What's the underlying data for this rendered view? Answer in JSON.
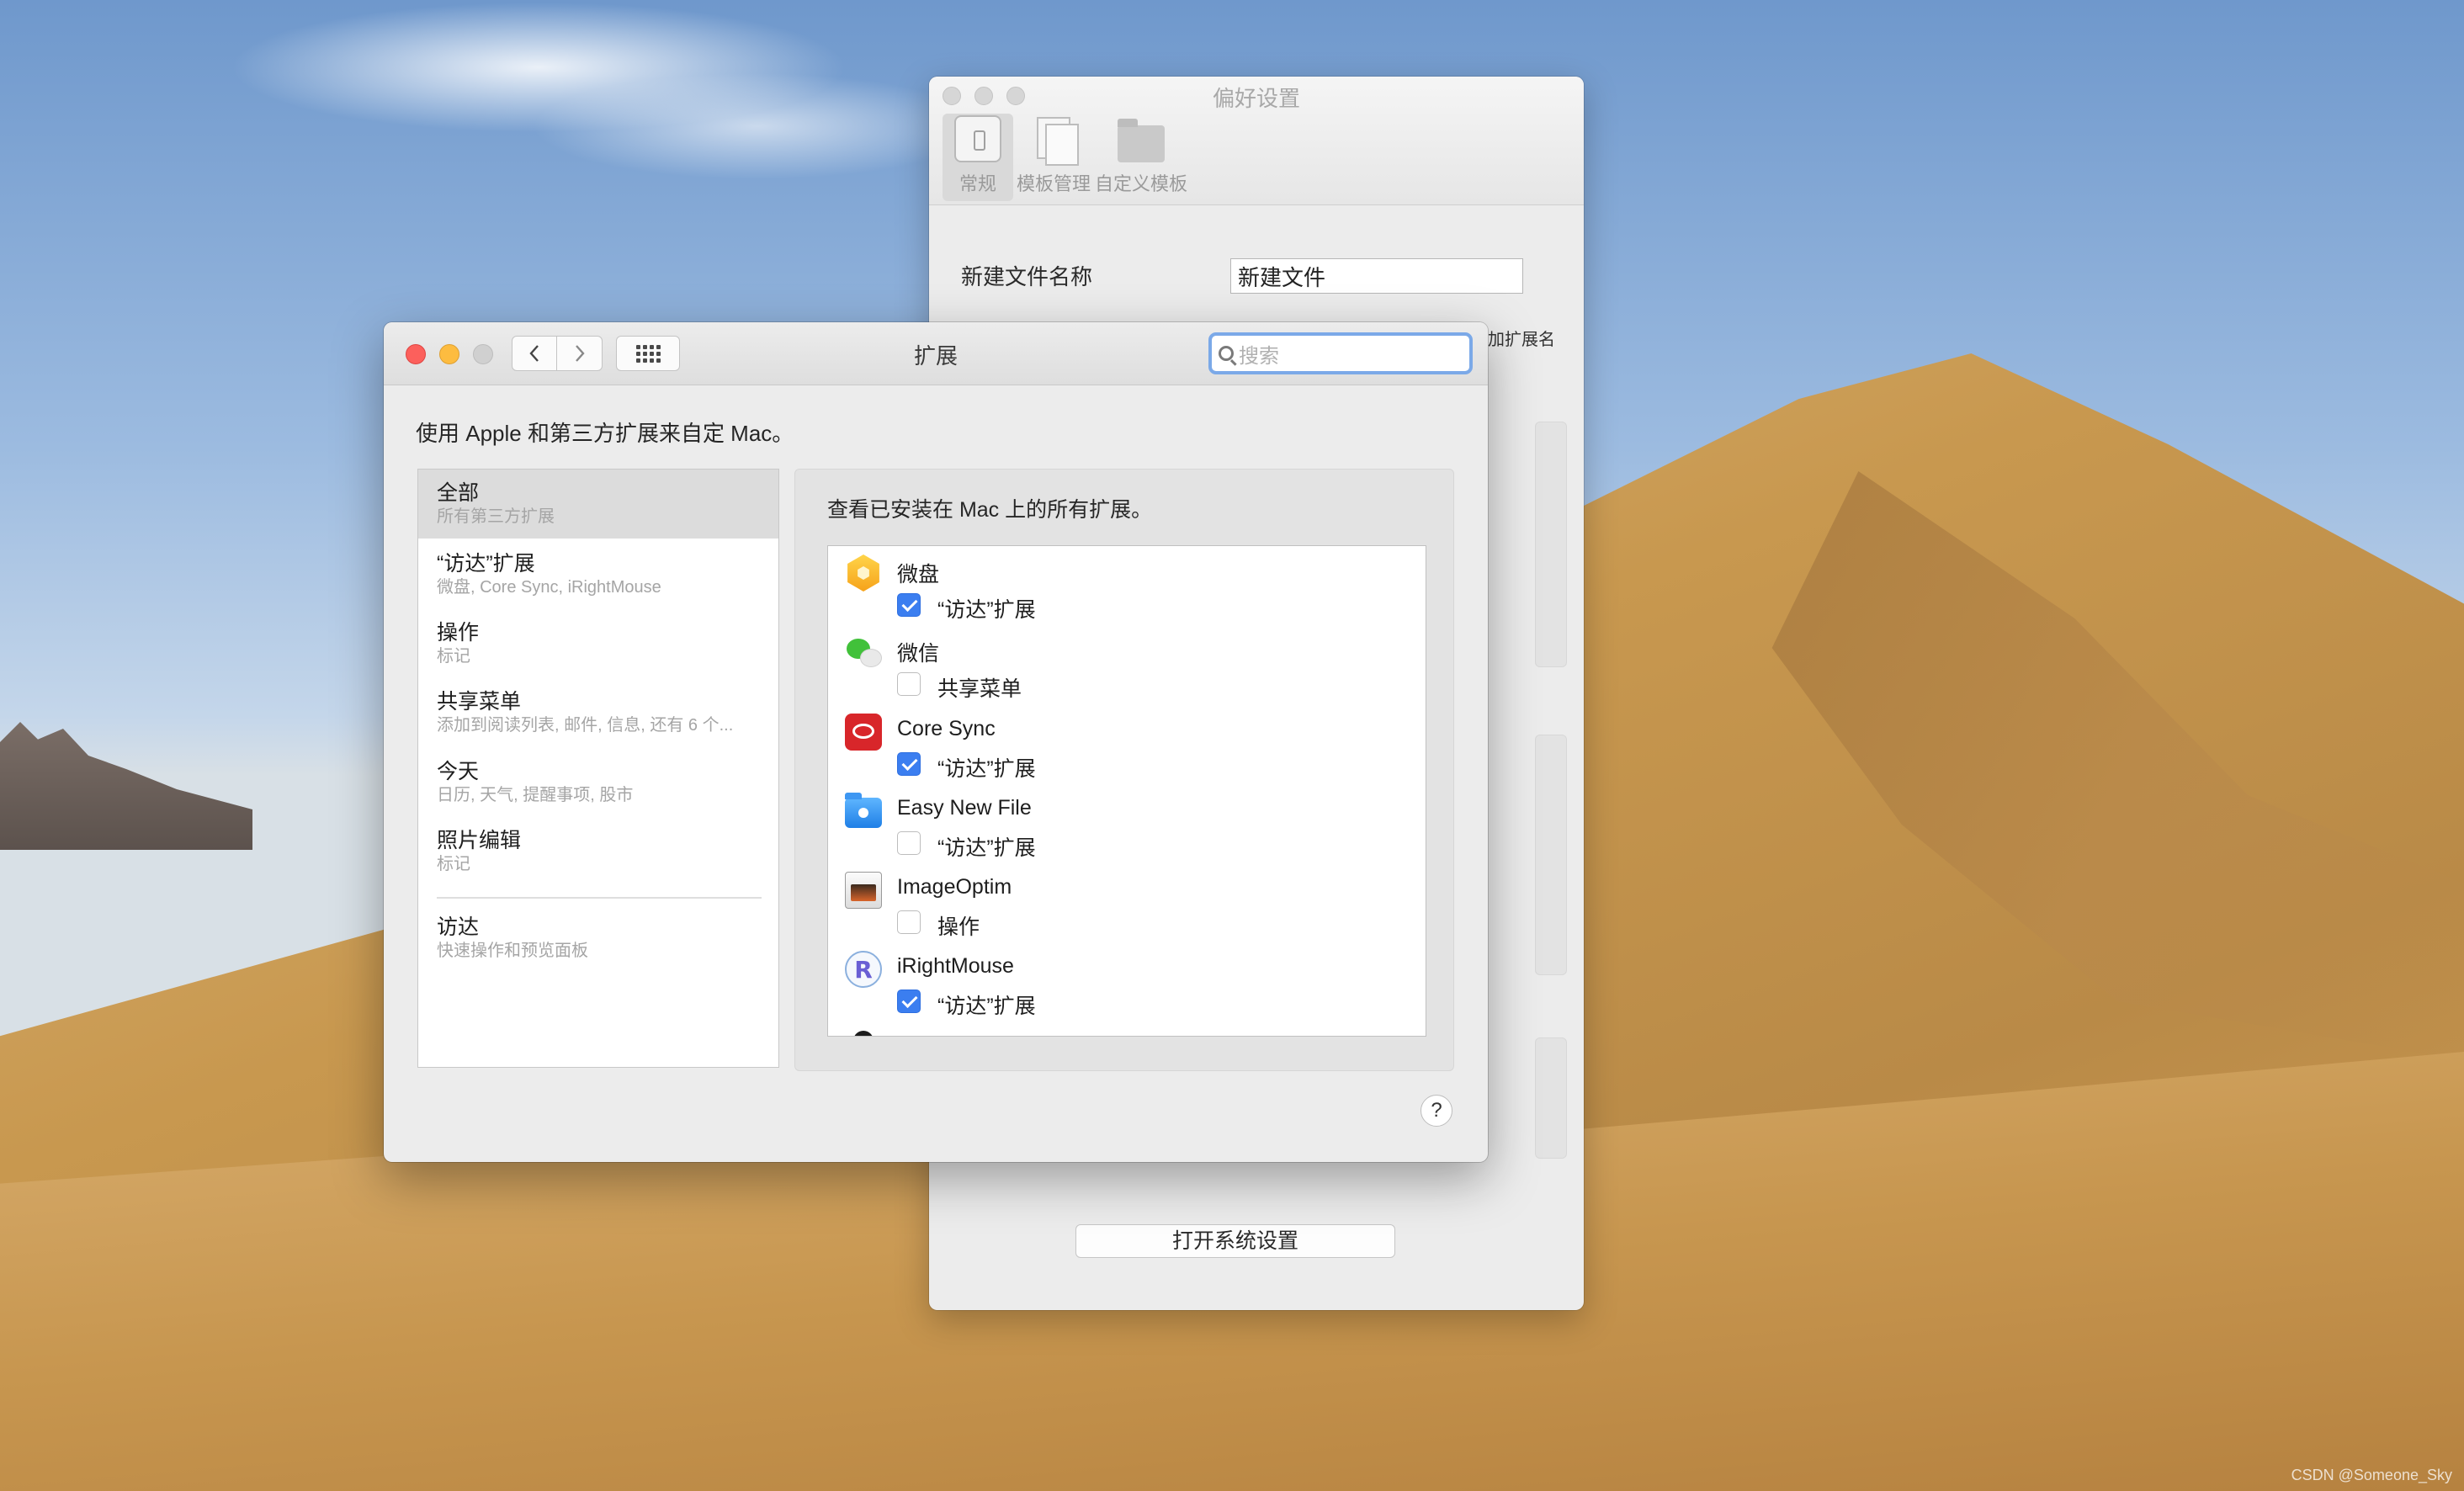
{
  "desktop": {
    "credit": "CSDN @Someone_Sky"
  },
  "prefs_window": {
    "title": "偏好设置",
    "tabs": [
      {
        "label": "常规",
        "icon": "switch-icon"
      },
      {
        "label": "模板管理",
        "icon": "documents-icon"
      },
      {
        "label": "自定义模板",
        "icon": "folder-icon"
      }
    ],
    "filename_label": "新建文件名称",
    "filename_value": "新建文件",
    "extension_label": "加扩展名",
    "open_settings_button": "打开系统设置"
  },
  "ext_window": {
    "title": "扩展",
    "search_placeholder": "搜索",
    "description": "使用 Apple 和第三方扩展来自定 Mac。",
    "categories": [
      {
        "title": "全部",
        "subtitle": "所有第三方扩展",
        "selected": true
      },
      {
        "title": "“访达”扩展",
        "subtitle": "微盘, Core Sync, iRightMouse"
      },
      {
        "title": "操作",
        "subtitle": "标记"
      },
      {
        "title": "共享菜单",
        "subtitle": "添加到阅读列表, 邮件, 信息, 还有 6 个..."
      },
      {
        "title": "今天",
        "subtitle": "日历, 天气, 提醒事项, 股市"
      },
      {
        "title": "照片编辑",
        "subtitle": "标记"
      },
      {
        "title": "访达",
        "subtitle": "快速操作和预览面板"
      }
    ],
    "panel_description": "查看已安装在 Mac 上的所有扩展。",
    "extensions": [
      {
        "app": "微盘",
        "type": "“访达”扩展",
        "enabled": true,
        "icon": "weipan-icon"
      },
      {
        "app": "微信",
        "type": "共享菜单",
        "enabled": false,
        "icon": "wechat-icon"
      },
      {
        "app": "Core Sync",
        "type": "“访达”扩展",
        "enabled": true,
        "icon": "creative-cloud-icon"
      },
      {
        "app": "Easy New File",
        "type": "“访达”扩展",
        "enabled": false,
        "icon": "easy-new-file-icon"
      },
      {
        "app": "ImageOptim",
        "type": "操作",
        "enabled": false,
        "icon": "imageoptim-icon"
      },
      {
        "app": "iRightMouse",
        "type": "“访达”扩展",
        "enabled": true,
        "icon": "irightmouse-icon"
      }
    ],
    "help_label": "?"
  }
}
